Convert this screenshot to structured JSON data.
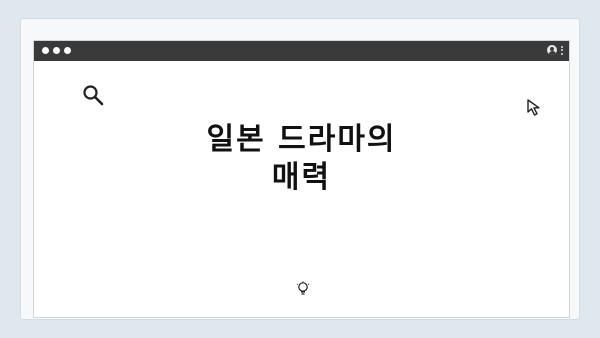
{
  "slide": {
    "title_line1": "일본 드라마의",
    "title_line2": "매력"
  },
  "icons": {
    "search": "search-icon",
    "cursor": "cursor-icon",
    "bulb": "lightbulb-icon",
    "user": "user-icon",
    "menu": "kebab-menu-icon"
  },
  "colors": {
    "background": "#dfe7ef",
    "titlebar": "#3a3a3a",
    "window": "#ffffff",
    "text": "#111111"
  }
}
